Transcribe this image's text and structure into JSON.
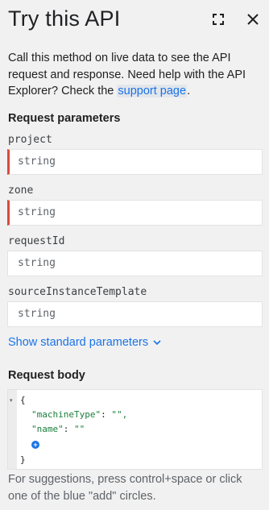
{
  "panel": {
    "title": "Try this API",
    "intro_text": "Call this method on live data to see the API request and response. Need help with the API Explorer? Check the ",
    "intro_link": "support page",
    "intro_end": "."
  },
  "request_parameters": {
    "heading": "Request parameters",
    "fields": [
      {
        "label": "project",
        "placeholder": "string",
        "required": true
      },
      {
        "label": "zone",
        "placeholder": "string",
        "required": true
      },
      {
        "label": "requestId",
        "placeholder": "string",
        "required": false
      },
      {
        "label": "sourceInstanceTemplate",
        "placeholder": "string",
        "required": false
      }
    ],
    "show_standard": "Show standard parameters"
  },
  "request_body": {
    "heading": "Request body",
    "lines": {
      "open": "{",
      "machine_type_key": "\"machineType\"",
      "machine_type_val": "\"\",",
      "name_key": "\"name\"",
      "name_val": "\"\"",
      "close": "}"
    },
    "add_symbol": "+",
    "hint": "For suggestions, press control+space or click one of the blue \"add\" circles."
  },
  "icons": {
    "fullscreen": "fullscreen-icon",
    "close": "close-icon",
    "chevron": "chevron-down-icon"
  },
  "colors": {
    "link": "#1a73e8",
    "required_marker": "#d84c3a",
    "background": "#f1f1f1"
  }
}
